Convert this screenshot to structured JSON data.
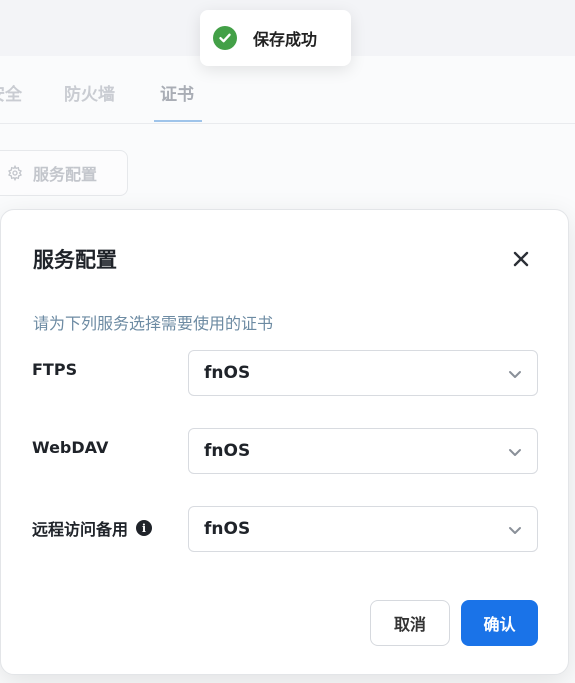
{
  "toast": {
    "message": "保存成功",
    "icon": "check-circle-icon",
    "color": "#43a047"
  },
  "background": {
    "tabs": [
      {
        "label": "安全",
        "active": false
      },
      {
        "label": "防火墙",
        "active": false
      },
      {
        "label": "证书",
        "active": true
      }
    ],
    "service_config_button": "服务配置"
  },
  "dialog": {
    "title": "服务配置",
    "subtitle": "请为下列服务选择需要使用的证书",
    "rows": [
      {
        "label": "FTPS",
        "value": "fnOS"
      },
      {
        "label": "WebDAV",
        "value": "fnOS"
      },
      {
        "label": "远程访问备用",
        "value": "fnOS",
        "has_info": true
      }
    ],
    "cancel_label": "取消",
    "confirm_label": "确认"
  },
  "colors": {
    "accent": "#1a73e8",
    "subtitle": "#6d8ba3"
  }
}
